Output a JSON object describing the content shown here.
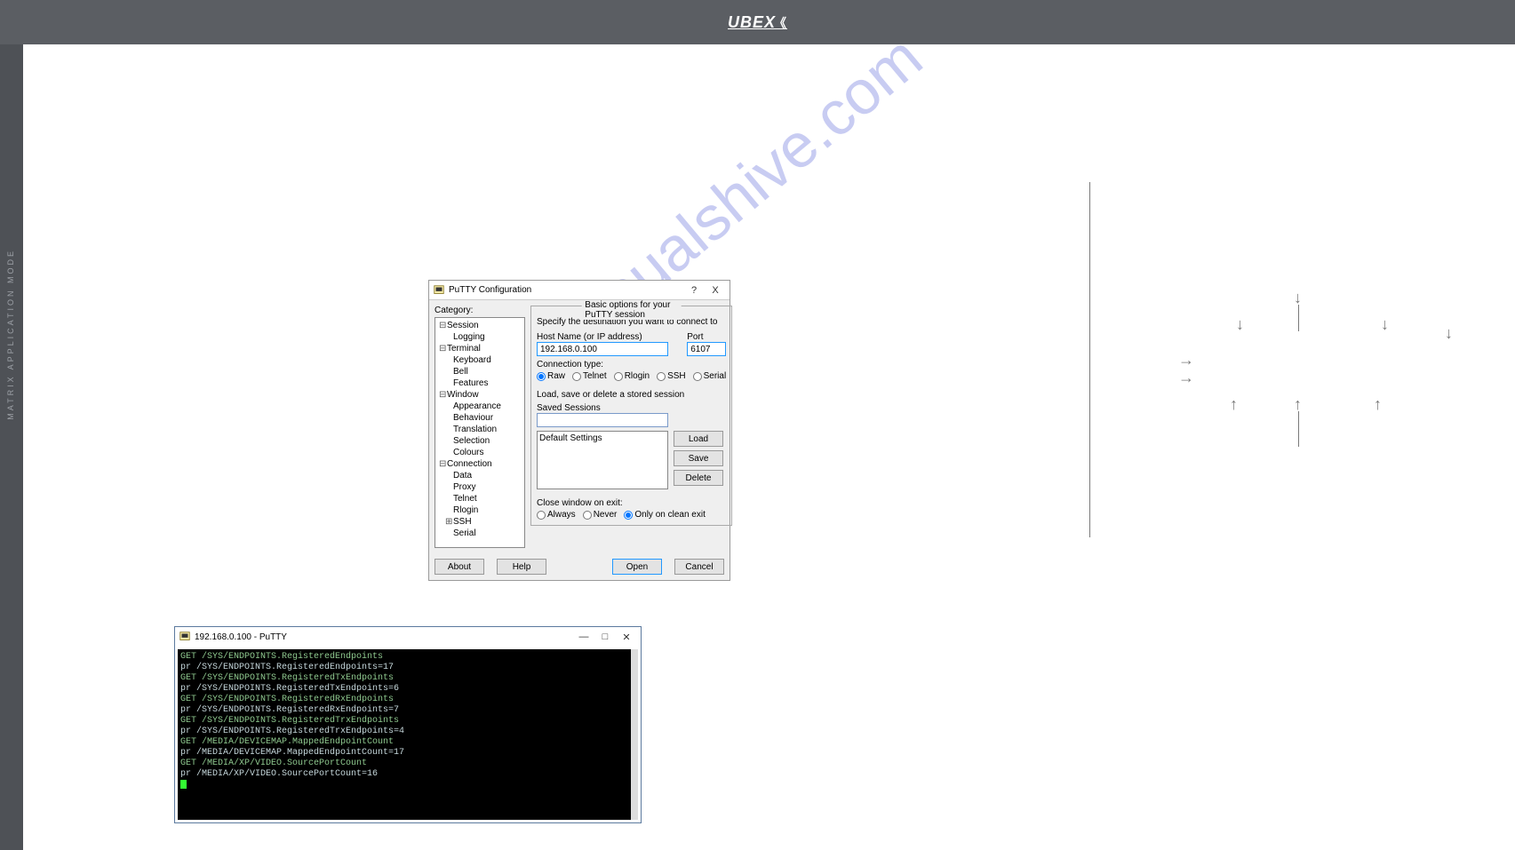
{
  "topbar": {
    "logo": "UBEX"
  },
  "sidebar": {
    "text": "MATRIX  APPLICATION  MODE"
  },
  "watermark": "manualshive.com",
  "putty": {
    "title": "PuTTY Configuration",
    "help_btn": "?",
    "close_btn": "X",
    "category_label": "Category:",
    "tree": {
      "session": "Session",
      "logging": "Logging",
      "terminal": "Terminal",
      "keyboard": "Keyboard",
      "bell": "Bell",
      "features": "Features",
      "window": "Window",
      "appearance": "Appearance",
      "behaviour": "Behaviour",
      "translation": "Translation",
      "selection": "Selection",
      "colours": "Colours",
      "connection": "Connection",
      "data": "Data",
      "proxy": "Proxy",
      "telnet": "Telnet",
      "rlogin": "Rlogin",
      "ssh": "SSH",
      "serial": "Serial"
    },
    "group_title": "Basic options for your PuTTY session",
    "specify_label": "Specify the destination you want to connect to",
    "host_label": "Host Name (or IP address)",
    "port_label": "Port",
    "host_value": "192.168.0.100",
    "port_value": "6107",
    "conn_type_label": "Connection type:",
    "raw": "Raw",
    "telnet_r": "Telnet",
    "rlogin_r": "Rlogin",
    "ssh_r": "SSH",
    "serial_r": "Serial",
    "lsd_label": "Load, save or delete a stored session",
    "saved_sessions": "Saved Sessions",
    "default_settings": "Default Settings",
    "load": "Load",
    "save": "Save",
    "delete": "Delete",
    "close_exit": "Close window on exit:",
    "always": "Always",
    "never": "Never",
    "clean": "Only on clean exit",
    "about": "About",
    "help": "Help",
    "open": "Open",
    "cancel": "Cancel"
  },
  "terminal": {
    "title": "192.168.0.100 - PuTTY",
    "lines": [
      {
        "s": "g",
        "t": "GET /SYS/ENDPOINTS.RegisteredEndpoints"
      },
      {
        "s": "w",
        "t": "pr /SYS/ENDPOINTS.RegisteredEndpoints=17"
      },
      {
        "s": "g",
        "t": "GET /SYS/ENDPOINTS.RegisteredTxEndpoints"
      },
      {
        "s": "w",
        "t": "pr /SYS/ENDPOINTS.RegisteredTxEndpoints=6"
      },
      {
        "s": "g",
        "t": "GET /SYS/ENDPOINTS.RegisteredRxEndpoints"
      },
      {
        "s": "w",
        "t": "pr /SYS/ENDPOINTS.RegisteredRxEndpoints=7"
      },
      {
        "s": "g",
        "t": "GET /SYS/ENDPOINTS.RegisteredTrxEndpoints"
      },
      {
        "s": "w",
        "t": "pr /SYS/ENDPOINTS.RegisteredTrxEndpoints=4"
      },
      {
        "s": "g",
        "t": "GET /MEDIA/DEVICEMAP.MappedEndpointCount"
      },
      {
        "s": "w",
        "t": "pr /MEDIA/DEVICEMAP.MappedEndpointCount=17"
      },
      {
        "s": "g",
        "t": "GET /MEDIA/XP/VIDEO.SourcePortCount"
      },
      {
        "s": "w",
        "t": "pr /MEDIA/XP/VIDEO.SourcePortCount=16"
      }
    ]
  }
}
